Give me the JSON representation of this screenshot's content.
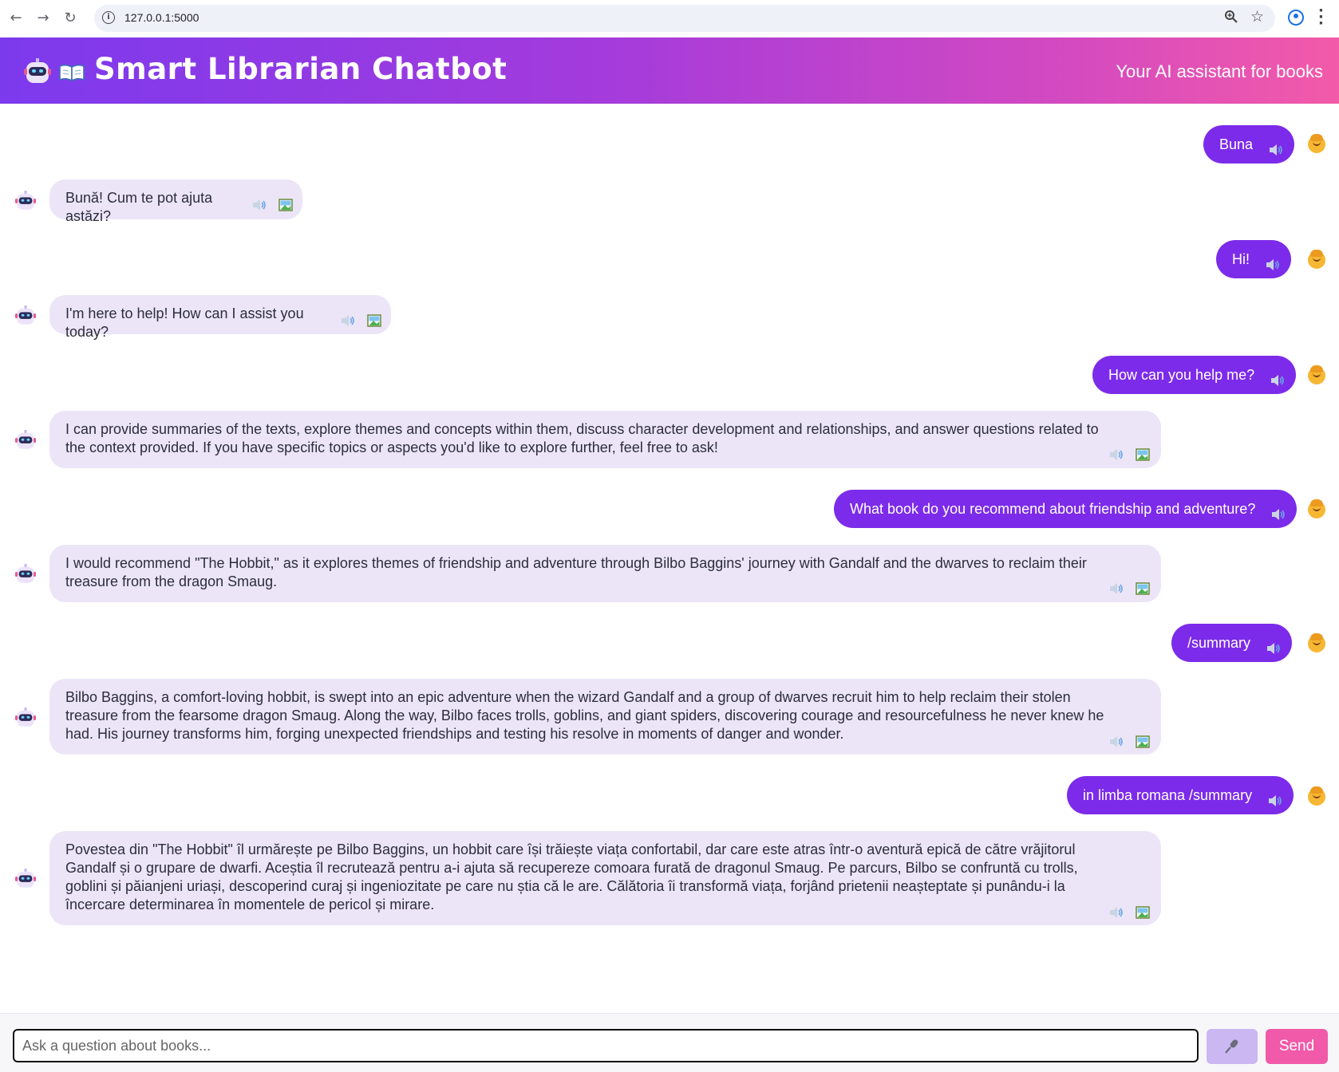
{
  "browser": {
    "url": "127.0.0.1:5000",
    "nav": {
      "back_glyph": "←",
      "forward_glyph": "→",
      "reload_glyph": "↻"
    },
    "icons": [
      "info-icon",
      "zoom-icon",
      "star-icon",
      "profile-icon",
      "menu-icon"
    ]
  },
  "header": {
    "title": "Smart Librarian Chatbot",
    "subtitle": "Your AI assistant for books",
    "logo_icons": [
      "robot-icon",
      "open-book-icon"
    ]
  },
  "messages": [
    {
      "role": "user",
      "text": "Buna"
    },
    {
      "role": "bot",
      "text": "Bună! Cum te pot ajuta astăzi?"
    },
    {
      "role": "user",
      "text": "Hi!"
    },
    {
      "role": "bot",
      "text": "I'm here to help! How can I assist you today?"
    },
    {
      "role": "user",
      "text": "How can you help me?"
    },
    {
      "role": "bot",
      "text": "I can provide summaries of the texts, explore themes and concepts within them, discuss character development and relationships, and answer questions related to the context provided. If you have specific topics or aspects you'd like to explore further, feel free to ask!"
    },
    {
      "role": "user",
      "text": "What book do you recommend about friendship and adventure?"
    },
    {
      "role": "bot",
      "text": "I would recommend \"The Hobbit,\" as it explores themes of friendship and adventure through Bilbo Baggins' journey with Gandalf and the dwarves to reclaim their treasure from the dragon Smaug."
    },
    {
      "role": "user",
      "text": "/summary"
    },
    {
      "role": "bot",
      "text": "Bilbo Baggins, a comfort-loving hobbit, is swept into an epic adventure when the wizard Gandalf and a group of dwarves recruit him to help reclaim their stolen treasure from the fearsome dragon Smaug. Along the way, Bilbo faces trolls, goblins, and giant spiders, discovering courage and resourcefulness he never knew he had. His journey transforms him, forging unexpected friendships and testing his resolve in moments of danger and wonder."
    },
    {
      "role": "user",
      "text": "in limba romana /summary"
    },
    {
      "role": "bot",
      "text": "Povestea din \"The Hobbit\" îl urmărește pe Bilbo Baggins, un hobbit care își trăiește viața confortabil, dar care este atras într-o aventură epică de către vrăjitorul Gandalf și o grupare de dwarfi. Aceștia îl recrutează pentru a-i ajuta să recupereze comoara furată de dragonul Smaug. Pe parcurs, Bilbo se confruntă cu trolls, goblini și păianjeni uriași, descoperind curaj și ingeniozitate pe care nu știa că le are. Călătoria îi transformă viața, forjând prietenii neașteptate și punându-i la încercare determinarea în momentele de pericol și mirare."
    }
  ],
  "input": {
    "placeholder": "Ask a question about books...",
    "value": "",
    "mic_icon": "microphone-icon",
    "send_label": "Send"
  },
  "colors": {
    "header_gradient_start": "#7c3aed",
    "header_gradient_end": "#f35aa8",
    "user_bubble": "#7c2bea",
    "bot_bubble": "#ebe5f7",
    "send_button": "#f05aa8",
    "mic_button": "#cbb8f3"
  }
}
